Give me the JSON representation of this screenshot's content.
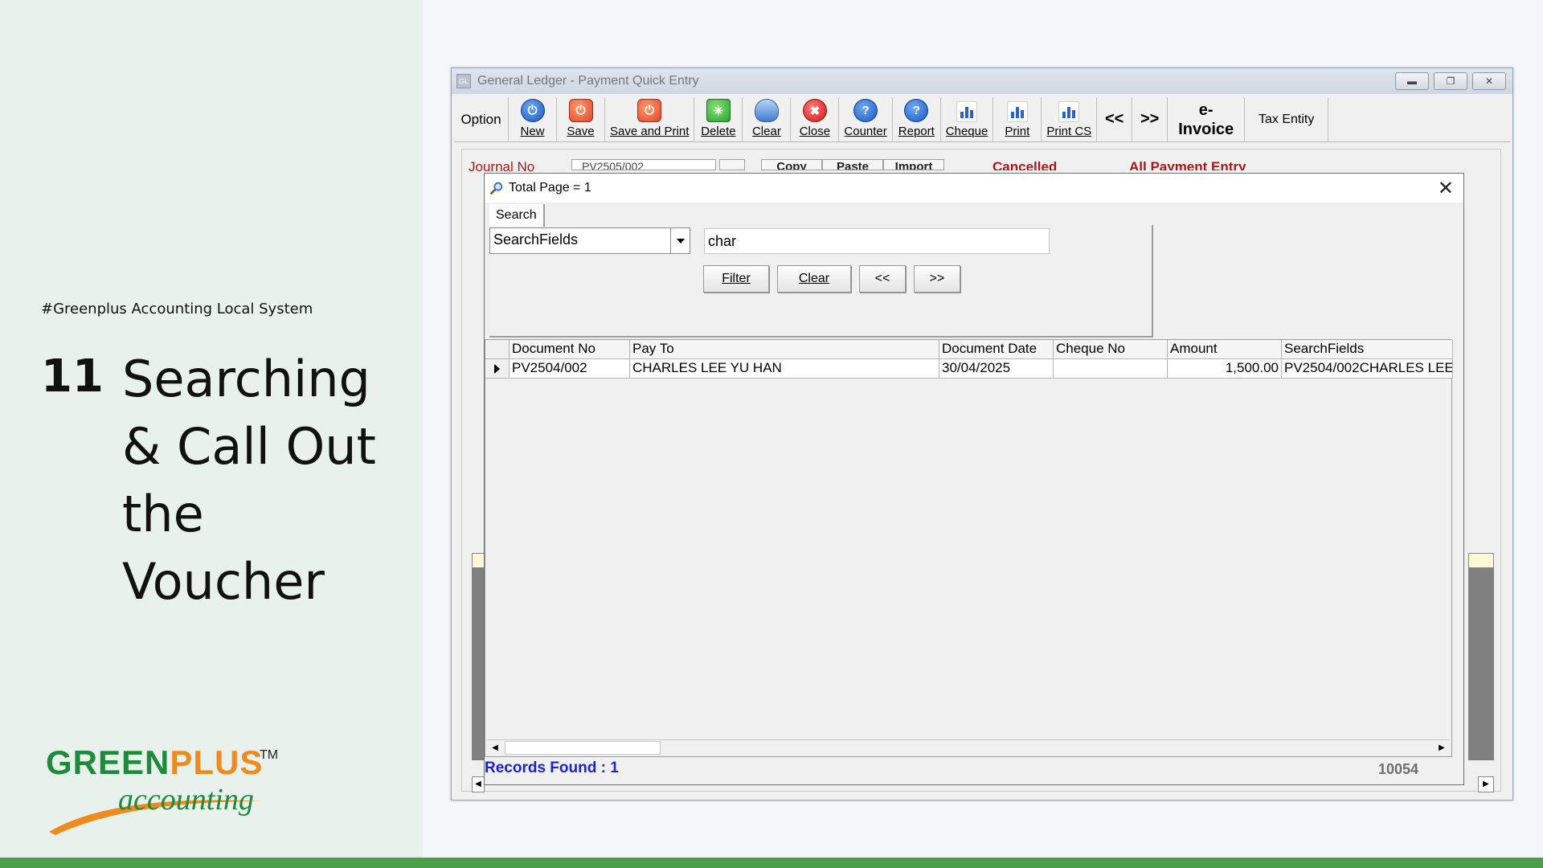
{
  "slide": {
    "hashtag": "#Greenplus Accounting Local System",
    "step_number": "11",
    "step_title": "Searching & Call Out the Voucher",
    "logo": {
      "word1": "GREEN",
      "word2": "PLUS",
      "tagline": "accounting",
      "tm": "TM"
    },
    "colors": {
      "panel": "#e8f1ec",
      "brand_green": "#1e8a3c",
      "brand_orange": "#f08a1c",
      "bottom_bar": "#4aa04a"
    }
  },
  "window": {
    "title": "General Ledger - Payment Quick Entry",
    "title_icon": "GL",
    "controls": [
      "minimize-icon",
      "restore-icon",
      "close-icon"
    ]
  },
  "toolbar": {
    "option": "Option",
    "buttons": [
      {
        "label": "New",
        "icon": "power-icon"
      },
      {
        "label": "Save",
        "icon": "save-icon"
      },
      {
        "label": "Save and Print",
        "icon": "save-print-icon"
      },
      {
        "label": "Delete",
        "icon": "delete-icon"
      },
      {
        "label": "Clear",
        "icon": "eraser-icon"
      },
      {
        "label": "Close",
        "icon": "close-icon"
      },
      {
        "label": "Counter",
        "icon": "help-icon"
      },
      {
        "label": "Report",
        "icon": "help-icon"
      },
      {
        "label": "Cheque",
        "icon": "chart-icon"
      },
      {
        "label": "Print",
        "icon": "chart-icon"
      },
      {
        "label": "Print CS",
        "icon": "chart-icon"
      }
    ],
    "prev": "<<",
    "next": ">>",
    "einvoice_line1": "e-",
    "einvoice_line2": "Invoice",
    "tax_entity": "Tax Entity"
  },
  "background_form": {
    "journal_no_label": "Journal No",
    "journal_no_value": "PV2505/002",
    "copy": "Copy",
    "paste": "Paste",
    "import": "Import",
    "cancelled": "Cancelled",
    "all_payment_entry": "All Payment Entry"
  },
  "dialog": {
    "title": "Total Page = 1",
    "tab": "Search",
    "field_select": "SearchFields",
    "search_value": "char",
    "buttons": {
      "filter": "Filter",
      "clear": "Clear",
      "prev": "<<",
      "next": ">>"
    },
    "columns": [
      "Document No",
      "Pay To",
      "Document Date",
      "Cheque No",
      "Amount",
      "SearchFields"
    ],
    "rows": [
      {
        "document_no": "PV2504/002",
        "pay_to": "CHARLES LEE YU HAN",
        "document_date": "30/04/2025",
        "cheque_no": "",
        "amount": "1,500.00",
        "search_fields": "PV2504/002CHARLES LEE"
      }
    ],
    "records_found": "Records Found : 1",
    "code": "10054"
  }
}
